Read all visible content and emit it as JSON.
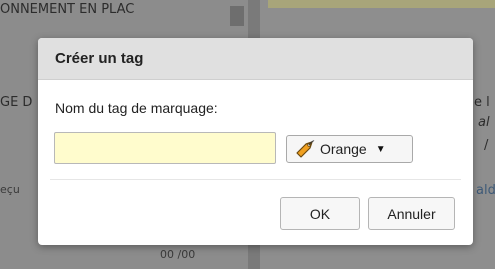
{
  "background": {
    "top_heading": "ONNEMENT EN PLAC",
    "left_label": "GE D",
    "left_small": "eçu",
    "bottom_small": "00 /00",
    "right_1": "e l",
    "right_2": "al",
    "right_3": "/",
    "right_4": "ald"
  },
  "dialog": {
    "title": "Créer un tag",
    "field_label": "Nom du tag de marquage:",
    "input_value": "",
    "color_select": {
      "selected": "Orange",
      "icon": "tag-icon",
      "icon_color": "#f0a020"
    },
    "ok_label": "OK",
    "cancel_label": "Annuler"
  }
}
